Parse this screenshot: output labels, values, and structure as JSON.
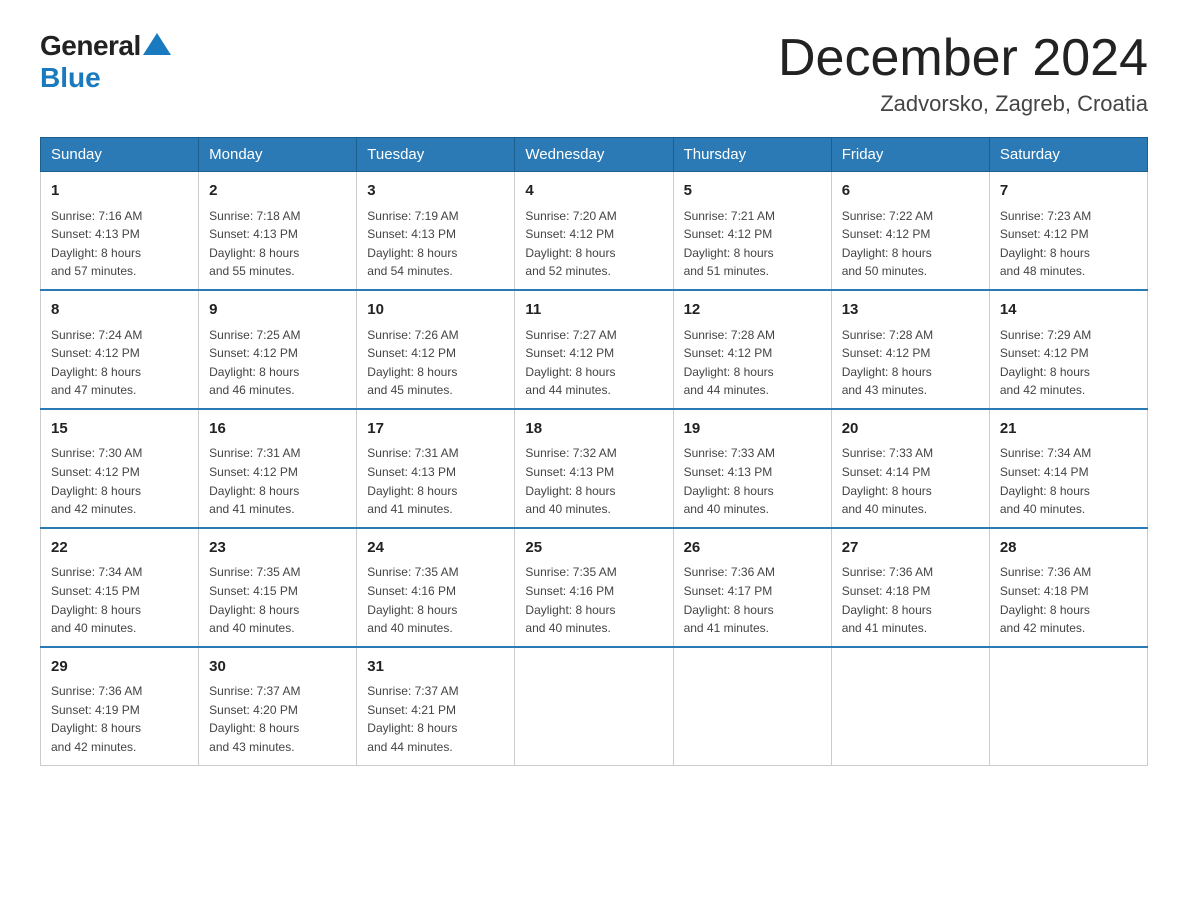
{
  "logo": {
    "general": "General",
    "blue": "Blue"
  },
  "header": {
    "month_year": "December 2024",
    "location": "Zadvorsko, Zagreb, Croatia"
  },
  "days_of_week": [
    "Sunday",
    "Monday",
    "Tuesday",
    "Wednesday",
    "Thursday",
    "Friday",
    "Saturday"
  ],
  "weeks": [
    [
      {
        "day": "1",
        "sunrise": "7:16 AM",
        "sunset": "4:13 PM",
        "daylight": "8 hours and 57 minutes."
      },
      {
        "day": "2",
        "sunrise": "7:18 AM",
        "sunset": "4:13 PM",
        "daylight": "8 hours and 55 minutes."
      },
      {
        "day": "3",
        "sunrise": "7:19 AM",
        "sunset": "4:13 PM",
        "daylight": "8 hours and 54 minutes."
      },
      {
        "day": "4",
        "sunrise": "7:20 AM",
        "sunset": "4:12 PM",
        "daylight": "8 hours and 52 minutes."
      },
      {
        "day": "5",
        "sunrise": "7:21 AM",
        "sunset": "4:12 PM",
        "daylight": "8 hours and 51 minutes."
      },
      {
        "day": "6",
        "sunrise": "7:22 AM",
        "sunset": "4:12 PM",
        "daylight": "8 hours and 50 minutes."
      },
      {
        "day": "7",
        "sunrise": "7:23 AM",
        "sunset": "4:12 PM",
        "daylight": "8 hours and 48 minutes."
      }
    ],
    [
      {
        "day": "8",
        "sunrise": "7:24 AM",
        "sunset": "4:12 PM",
        "daylight": "8 hours and 47 minutes."
      },
      {
        "day": "9",
        "sunrise": "7:25 AM",
        "sunset": "4:12 PM",
        "daylight": "8 hours and 46 minutes."
      },
      {
        "day": "10",
        "sunrise": "7:26 AM",
        "sunset": "4:12 PM",
        "daylight": "8 hours and 45 minutes."
      },
      {
        "day": "11",
        "sunrise": "7:27 AM",
        "sunset": "4:12 PM",
        "daylight": "8 hours and 44 minutes."
      },
      {
        "day": "12",
        "sunrise": "7:28 AM",
        "sunset": "4:12 PM",
        "daylight": "8 hours and 44 minutes."
      },
      {
        "day": "13",
        "sunrise": "7:28 AM",
        "sunset": "4:12 PM",
        "daylight": "8 hours and 43 minutes."
      },
      {
        "day": "14",
        "sunrise": "7:29 AM",
        "sunset": "4:12 PM",
        "daylight": "8 hours and 42 minutes."
      }
    ],
    [
      {
        "day": "15",
        "sunrise": "7:30 AM",
        "sunset": "4:12 PM",
        "daylight": "8 hours and 42 minutes."
      },
      {
        "day": "16",
        "sunrise": "7:31 AM",
        "sunset": "4:12 PM",
        "daylight": "8 hours and 41 minutes."
      },
      {
        "day": "17",
        "sunrise": "7:31 AM",
        "sunset": "4:13 PM",
        "daylight": "8 hours and 41 minutes."
      },
      {
        "day": "18",
        "sunrise": "7:32 AM",
        "sunset": "4:13 PM",
        "daylight": "8 hours and 40 minutes."
      },
      {
        "day": "19",
        "sunrise": "7:33 AM",
        "sunset": "4:13 PM",
        "daylight": "8 hours and 40 minutes."
      },
      {
        "day": "20",
        "sunrise": "7:33 AM",
        "sunset": "4:14 PM",
        "daylight": "8 hours and 40 minutes."
      },
      {
        "day": "21",
        "sunrise": "7:34 AM",
        "sunset": "4:14 PM",
        "daylight": "8 hours and 40 minutes."
      }
    ],
    [
      {
        "day": "22",
        "sunrise": "7:34 AM",
        "sunset": "4:15 PM",
        "daylight": "8 hours and 40 minutes."
      },
      {
        "day": "23",
        "sunrise": "7:35 AM",
        "sunset": "4:15 PM",
        "daylight": "8 hours and 40 minutes."
      },
      {
        "day": "24",
        "sunrise": "7:35 AM",
        "sunset": "4:16 PM",
        "daylight": "8 hours and 40 minutes."
      },
      {
        "day": "25",
        "sunrise": "7:35 AM",
        "sunset": "4:16 PM",
        "daylight": "8 hours and 40 minutes."
      },
      {
        "day": "26",
        "sunrise": "7:36 AM",
        "sunset": "4:17 PM",
        "daylight": "8 hours and 41 minutes."
      },
      {
        "day": "27",
        "sunrise": "7:36 AM",
        "sunset": "4:18 PM",
        "daylight": "8 hours and 41 minutes."
      },
      {
        "day": "28",
        "sunrise": "7:36 AM",
        "sunset": "4:18 PM",
        "daylight": "8 hours and 42 minutes."
      }
    ],
    [
      {
        "day": "29",
        "sunrise": "7:36 AM",
        "sunset": "4:19 PM",
        "daylight": "8 hours and 42 minutes."
      },
      {
        "day": "30",
        "sunrise": "7:37 AM",
        "sunset": "4:20 PM",
        "daylight": "8 hours and 43 minutes."
      },
      {
        "day": "31",
        "sunrise": "7:37 AM",
        "sunset": "4:21 PM",
        "daylight": "8 hours and 44 minutes."
      },
      null,
      null,
      null,
      null
    ]
  ],
  "labels": {
    "sunrise": "Sunrise:",
    "sunset": "Sunset:",
    "daylight": "Daylight:"
  }
}
